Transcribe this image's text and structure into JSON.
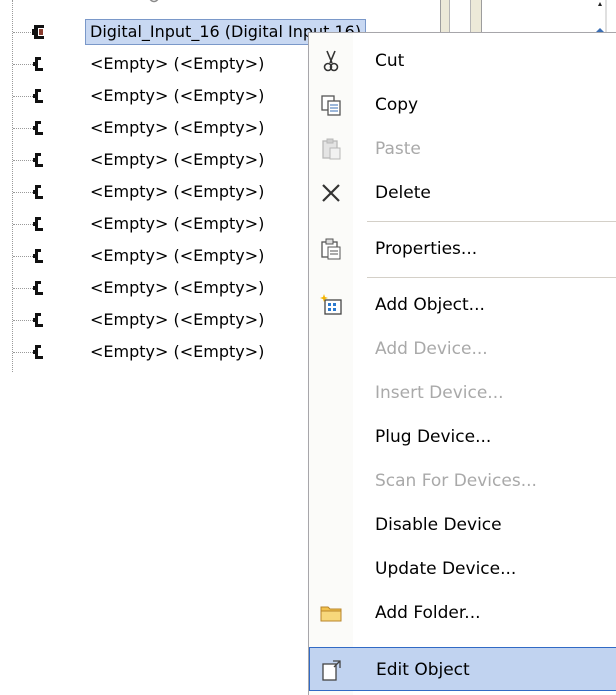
{
  "tree": {
    "selected_label": "Digital_Input_16 (Digital Input 16)",
    "items": [
      {
        "label": "<Empty> (<Empty>)"
      },
      {
        "label": "<Empty> (<Empty>)"
      },
      {
        "label": "<Empty> (<Empty>)"
      },
      {
        "label": "<Empty> (<Empty>)"
      },
      {
        "label": "<Empty> (<Empty>)"
      },
      {
        "label": "<Empty> (<Empty>)"
      },
      {
        "label": "<Empty> (<Empty>)"
      },
      {
        "label": "<Empty> (<Empty>)"
      },
      {
        "label": "<Empty> (<Empty>)"
      },
      {
        "label": "<Empty> (<Empty>)"
      }
    ]
  },
  "context_menu": {
    "items": [
      {
        "label": "Cut",
        "icon": "scissors-icon",
        "enabled": true
      },
      {
        "label": "Copy",
        "icon": "copy-icon",
        "enabled": true
      },
      {
        "label": "Paste",
        "icon": "paste-icon",
        "enabled": false
      },
      {
        "label": "Delete",
        "icon": "delete-icon",
        "enabled": true
      },
      {
        "label": "Properties...",
        "icon": "properties-icon",
        "enabled": true
      },
      {
        "label": "Add Object...",
        "icon": "add-object-icon",
        "enabled": true
      },
      {
        "label": "Add Device...",
        "icon": "",
        "enabled": false
      },
      {
        "label": "Insert Device...",
        "icon": "",
        "enabled": false
      },
      {
        "label": "Plug Device...",
        "icon": "",
        "enabled": true
      },
      {
        "label": "Scan For Devices...",
        "icon": "",
        "enabled": false
      },
      {
        "label": "Disable Device",
        "icon": "",
        "enabled": true
      },
      {
        "label": "Update Device...",
        "icon": "",
        "enabled": true
      },
      {
        "label": "Add Folder...",
        "icon": "folder-icon",
        "enabled": true
      },
      {
        "label": "Edit Object",
        "icon": "edit-object-icon",
        "enabled": true,
        "highlighted": true
      }
    ]
  },
  "colors": {
    "selection_bg": "#c8d8f2",
    "menu_highlight": "#c1d3f0",
    "disabled_text": "#a9a9a9"
  }
}
